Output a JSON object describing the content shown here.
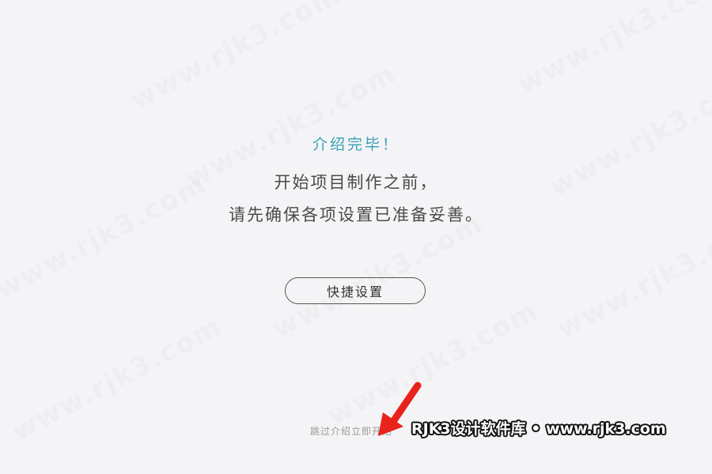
{
  "intro": {
    "title": "介绍完毕！",
    "line1": "开始项目制作之前，",
    "line2": "请先确保各项设置已准备妥善。"
  },
  "actions": {
    "quick_settings_label": "快捷设置",
    "skip_label": "跳过介绍立即开始"
  },
  "watermark": {
    "brand_text": "RJK3设计软件库 • www.rjk3.com",
    "repeat_text": "www.rjk3.com"
  },
  "colors": {
    "background": "#f4f4f6",
    "title": "#3aa0b5",
    "body_text": "#4a4a4a",
    "arrow": "#e8231b"
  }
}
